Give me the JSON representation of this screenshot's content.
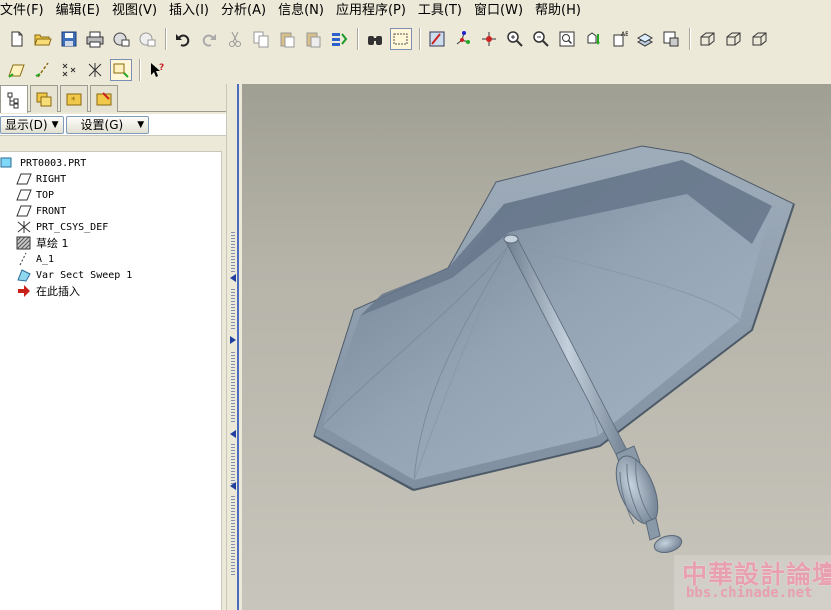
{
  "menu": [
    {
      "label": "文件(F)"
    },
    {
      "label": "编辑(E)"
    },
    {
      "label": "视图(V)"
    },
    {
      "label": "插入(I)"
    },
    {
      "label": "分析(A)"
    },
    {
      "label": "信息(N)"
    },
    {
      "label": "应用程序(P)"
    },
    {
      "label": "工具(T)"
    },
    {
      "label": "窗口(W)"
    },
    {
      "label": "帮助(H)"
    }
  ],
  "toolbar1": [
    "new-icon",
    "open-icon",
    "save-icon",
    "print-icon",
    "send-mail-icon",
    "send-attach-icon",
    "undo-icon",
    "redo-icon",
    "cut-icon",
    "copy-icon",
    "paste-icon",
    "paste-special-icon",
    "regenerate-icon",
    "find-icon",
    "select-box-icon",
    "repaint-icon",
    "spin-center-icon",
    "orient-icon",
    "zoom-in-icon",
    "zoom-out-icon",
    "refit-icon",
    "reorient-icon",
    "named-view-icon",
    "layers-icon",
    "view-manager-icon",
    "wireframe-icon",
    "hidden-line-icon",
    "no-hidden-icon"
  ],
  "toolbar2": [
    "datum-plane-icon",
    "datum-axis-icon",
    "datum-point-icon",
    "csys-icon",
    "annotation-icon",
    "context-help-icon"
  ],
  "nav": {
    "show_label": "显示(D)",
    "settings_label": "设置(G)"
  },
  "tree": [
    {
      "label": "PRT0003.PRT",
      "icon": "part-icon"
    },
    {
      "label": "RIGHT",
      "icon": "datum-plane-icon"
    },
    {
      "label": "TOP",
      "icon": "datum-plane-icon"
    },
    {
      "label": "FRONT",
      "icon": "datum-plane-icon"
    },
    {
      "label": "PRT_CSYS_DEF",
      "icon": "csys-icon"
    },
    {
      "label": "草绘 1",
      "icon": "sketch-icon"
    },
    {
      "label": "A_1",
      "icon": "axis-icon"
    },
    {
      "label": "Var Sect Sweep 1",
      "icon": "sweep-icon"
    },
    {
      "label": "在此插入",
      "icon": "insert-here-icon"
    }
  ],
  "watermark": {
    "title": "中華設計論壇",
    "url": "bbs.chinade.net"
  },
  "colors": {
    "menu_bg": "#ece9d8",
    "viewport_top": "#a09f94",
    "viewport_bottom": "#c8c6bc",
    "model": "#7d8ea0",
    "watermark": "#e8a0b0"
  }
}
